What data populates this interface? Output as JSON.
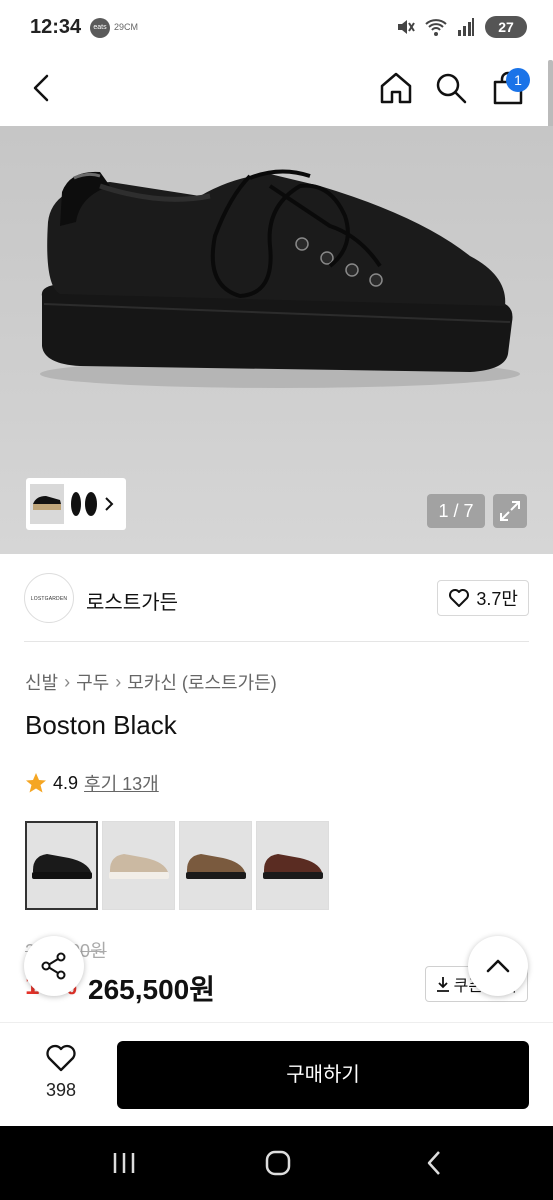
{
  "status_bar": {
    "time": "12:34",
    "app_icon_text": "eats",
    "small_label": "29CM",
    "battery": "27"
  },
  "header": {
    "cart_count": "1"
  },
  "gallery": {
    "counter": "1 / 7"
  },
  "brand": {
    "logo_text": "LOSTGARDEN",
    "name": "로스트가든",
    "likes": "3.7만"
  },
  "breadcrumb": [
    "신발",
    "구두",
    "모카신 (로스트가든)"
  ],
  "product": {
    "title": "Boston Black",
    "rating": "4.9",
    "reviews": "후기 13개"
  },
  "swatches": [
    {
      "color": "#1a1a1a",
      "sole": "#111"
    },
    {
      "color": "#cbb9a2",
      "sole": "#f2eee8"
    },
    {
      "color": "#7a5a3e",
      "sole": "#1a1a1a"
    },
    {
      "color": "#5a2c22",
      "sole": "#1a1a1a"
    }
  ],
  "price": {
    "original": "295,000원",
    "discount": "10%",
    "sale": "265,500원",
    "coupon": "쿠폰 받기"
  },
  "bottom": {
    "wish_count": "398",
    "buy_label": "구매하기"
  },
  "colors": {
    "accent_blue": "#1a73e8",
    "discount_red": "#e5332a"
  }
}
